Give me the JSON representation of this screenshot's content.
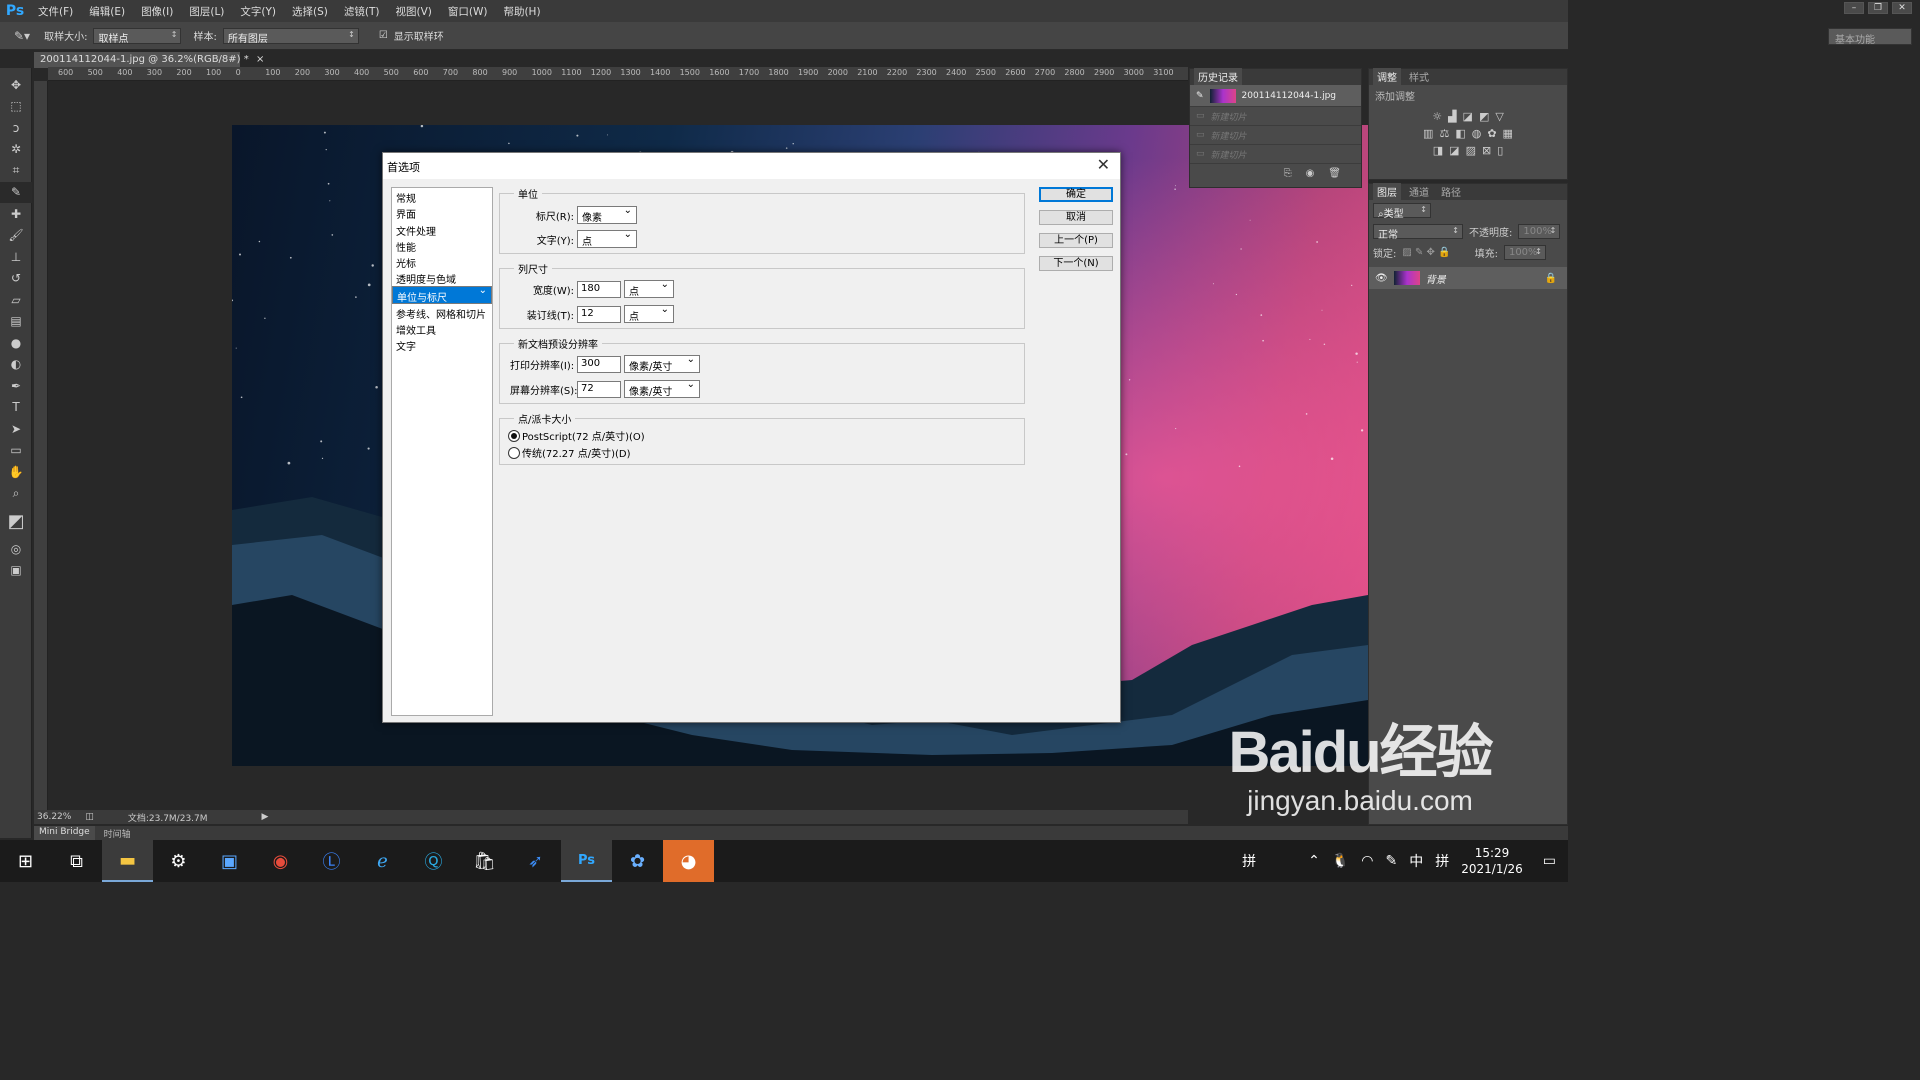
{
  "app": {
    "logo": "Ps"
  },
  "menu": [
    "文件(F)",
    "编辑(E)",
    "图像(I)",
    "图层(L)",
    "文字(Y)",
    "选择(S)",
    "滤镜(T)",
    "视图(V)",
    "窗口(W)",
    "帮助(H)"
  ],
  "options": {
    "sample_size_label": "取样大小:",
    "sample_size_value": "取样点",
    "sample_label": "样本:",
    "sample_value": "所有图层",
    "show_ring_label": "显示取样环",
    "workspace": "基本功能"
  },
  "document": {
    "tab_title": "200114112044-1.jpg @ 36.2%(RGB/8#) *",
    "zoom": "36.22%",
    "doc_size": "文档:23.7M/23.7M"
  },
  "ruler_ticks": [
    "600",
    "500",
    "400",
    "300",
    "200",
    "100",
    "0",
    "100",
    "200",
    "300",
    "400",
    "500",
    "600",
    "700",
    "800",
    "900",
    "1000",
    "1100",
    "1200",
    "1300",
    "1400",
    "1500",
    "1600",
    "1700",
    "1800",
    "1900",
    "2000",
    "2100",
    "2200",
    "2300",
    "2400",
    "2500",
    "2600",
    "2700",
    "2800",
    "2900",
    "3000",
    "3100"
  ],
  "bottom_tabs": [
    "Mini Bridge",
    "时间轴"
  ],
  "history_panel": {
    "tab": "历史记录",
    "source": "200114112044-1.jpg",
    "items": [
      "新建切片",
      "新建切片",
      "新建切片"
    ]
  },
  "adjust_panel": {
    "tabs": [
      "调整",
      "样式"
    ],
    "title": "添加调整"
  },
  "layers_panel": {
    "tabs": [
      "图层",
      "通道",
      "路径"
    ],
    "filter": "类型",
    "blend": "正常",
    "opacity_label": "不透明度:",
    "opacity": "100%",
    "lock_label": "锁定:",
    "fill_label": "填充:",
    "fill": "100%",
    "layer_name": "背景"
  },
  "dialog": {
    "title": "首选项",
    "nav": [
      "常规",
      "界面",
      "文件处理",
      "性能",
      "光标",
      "透明度与色域",
      "单位与标尺",
      "参考线、网格和切片",
      "增效工具",
      "文字"
    ],
    "nav_selected": 6,
    "units": {
      "title": "单位",
      "ruler_label": "标尺(R):",
      "ruler_value": "像素",
      "type_label": "文字(Y):",
      "type_value": "点"
    },
    "column": {
      "title": "列尺寸",
      "width_label": "宽度(W):",
      "width_value": "180",
      "width_unit": "点",
      "gutter_label": "装订线(T):",
      "gutter_value": "12",
      "gutter_unit": "点"
    },
    "resolution": {
      "title": "新文档预设分辨率",
      "print_label": "打印分辨率(I):",
      "print_value": "300",
      "print_unit": "像素/英寸",
      "screen_label": "屏幕分辨率(S):",
      "screen_value": "72",
      "screen_unit": "像素/英寸"
    },
    "point": {
      "title": "点/派卡大小",
      "opt1": "PostScript(72 点/英寸)(O)",
      "opt2": "传统(72.27 点/英寸)(D)"
    },
    "buttons": {
      "ok": "确定",
      "cancel": "取消",
      "prev": "上一个(P)",
      "next": "下一个(N)"
    }
  },
  "taskbar": {
    "tray_lang": "中",
    "tray_ime": "拼",
    "time": "15:29",
    "date": "2021/1/26"
  },
  "watermark": {
    "line1": "Baidu经验",
    "line2": "jingyan.baidu.com"
  }
}
